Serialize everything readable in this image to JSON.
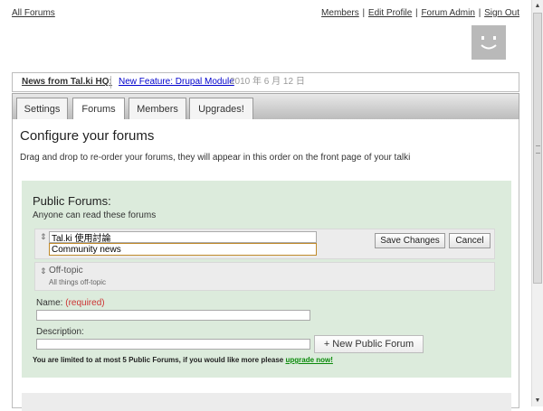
{
  "top": {
    "all_forums": "All Forums",
    "links": [
      "Members",
      "Edit Profile",
      "Forum Admin",
      "Sign Out"
    ],
    "separator": "|"
  },
  "news": {
    "title": "News from Tal.ki HQ:",
    "link": "New Feature: Drupal Module",
    "date": "2010 年 6 月 12 日"
  },
  "tabs": [
    {
      "label": "Settings"
    },
    {
      "label": "Forums"
    },
    {
      "label": "Members"
    },
    {
      "label": "Upgrades!"
    }
  ],
  "page": {
    "title": "Configure your forums",
    "description": "Drag and drop to re-order your forums, they will appear in this order on the front page of your talki"
  },
  "public_forums": {
    "title": "Public Forums:",
    "subtitle": "Anyone can read these forums",
    "drag_handle": "⇕",
    "editing": {
      "name_value": "Tal.ki 使用討論",
      "description_value": "Community news",
      "save_label": "Save Changes",
      "cancel_label": "Cancel"
    },
    "forums": [
      {
        "name": "Off-topic",
        "description": "All things off-topic"
      }
    ],
    "form": {
      "name_label": "Name:",
      "required_label": "(required)",
      "description_label": "Description:",
      "new_button_label": "+ New Public Forum",
      "limit_text": "You are limited to at most 5 Public Forums, if you would like more please ",
      "upgrade_link": "upgrade now!"
    }
  },
  "scrollbar": {
    "up": "▲",
    "down": "▼"
  }
}
